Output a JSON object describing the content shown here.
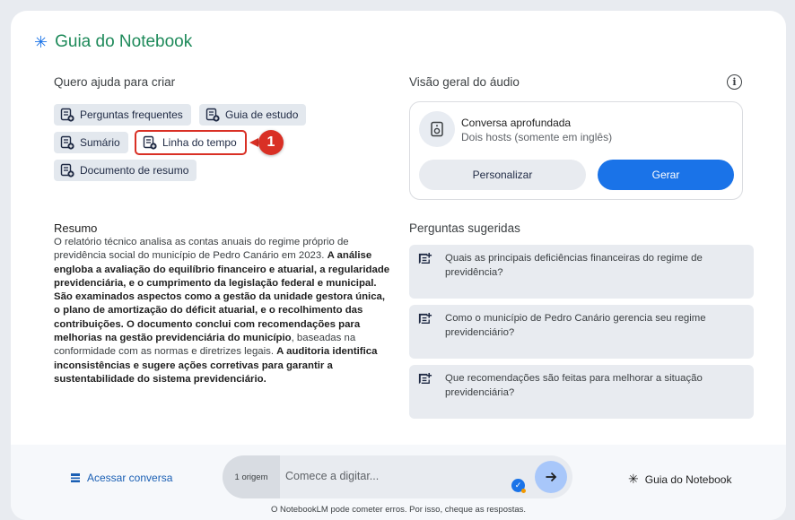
{
  "header": {
    "title": "Guia do Notebook",
    "icon": "sparkle-icon"
  },
  "create_help": {
    "label": "Quero ajuda para criar",
    "chips": [
      {
        "label": "Perguntas frequentes",
        "icon": "note-icon"
      },
      {
        "label": "Guia de estudo",
        "icon": "note-icon"
      },
      {
        "label": "Sumário",
        "icon": "note-icon"
      },
      {
        "label": "Linha do tempo",
        "icon": "note-icon"
      },
      {
        "label": "Documento de resumo",
        "icon": "note-icon"
      }
    ],
    "annotation": "1"
  },
  "summary": {
    "heading": "Resumo",
    "segments": [
      {
        "text": "O relatório técnico analisa as contas anuais do regime próprio de previdência social do município de Pedro Canário em 2023. ",
        "bold": false
      },
      {
        "text": "A análise engloba a avaliação do equilíbrio financeiro e atuarial, a regularidade previdenciária, e o cumprimento da legislação federal e municipal. São examinados aspectos como a gestão da unidade gestora única, o plano de amortização do déficit atuarial, e o recolhimento das contribuições. O documento conclui com recomendações para melhorias na gestão previdenciária do município",
        "bold": true
      },
      {
        "text": ", baseadas na conformidade com as normas e diretrizes legais. ",
        "bold": false
      },
      {
        "text": "A auditoria identifica inconsistências e sugere ações corretivas para garantir a sustentabilidade do sistema previdenciário.",
        "bold": true
      }
    ]
  },
  "audio": {
    "label": "Visão geral do áudio",
    "info_icon": "info-icon",
    "title": "Conversa aprofundada",
    "subtitle": "Dois hosts (somente em inglês)",
    "customize_label": "Personalizar",
    "generate_label": "Gerar"
  },
  "suggested": {
    "label": "Perguntas sugeridas",
    "questions": [
      "Quais as principais deficiências financeiras do regime de previdência?",
      "Como o município de Pedro Canário gerencia seu regime previdenciário?",
      "Que recomendações são feitas para melhorar a situação previdenciária?"
    ]
  },
  "footer": {
    "open_chat_label": "Acessar conversa",
    "source_count": "1 origem",
    "input_placeholder": "Comece a digitar...",
    "guide_label": "Guia do Notebook",
    "disclaimer": "O NotebookLM pode cometer erros. Por isso, cheque as respostas."
  },
  "colors": {
    "accent": "#1a73e8",
    "title_green": "#1e8a5a",
    "annotation_red": "#d93025",
    "chip_bg": "#e3e8ee"
  }
}
